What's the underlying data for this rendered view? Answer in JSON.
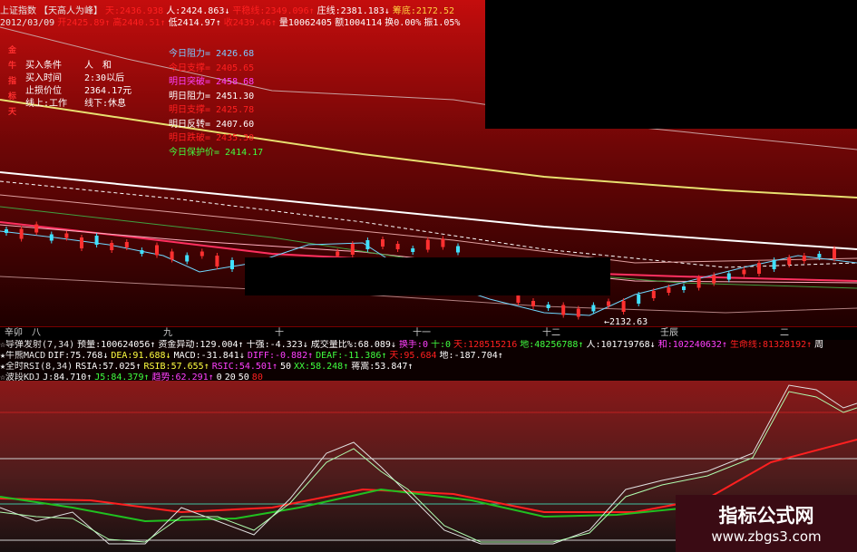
{
  "header": {
    "row1": [
      {
        "text": "上证指数",
        "color": "#e8e8e8"
      },
      {
        "text": "【天高人为峰】",
        "color": "#e8e8e8"
      },
      {
        "text": "天:2436.938",
        "color": "#ff2020"
      },
      {
        "text": "人:2424.863↓",
        "color": "#ffffff"
      },
      {
        "text": "平稳线:2349.096↑",
        "color": "#ff2020"
      },
      {
        "text": "庄线:2381.183↓",
        "color": "#ffffff"
      },
      {
        "text": "筹底:2172.52",
        "color": "#ffd040"
      }
    ],
    "row2": [
      {
        "text": "2012/03/09",
        "color": "#e8e8e8"
      },
      {
        "text": "开2425.89↑",
        "color": "#ff2020"
      },
      {
        "text": "高2440.51↑",
        "color": "#ff2020"
      },
      {
        "text": "低2414.97↑",
        "color": "#ffffff"
      },
      {
        "text": "收2439.46↑",
        "color": "#ff2020"
      },
      {
        "text": "量10062405",
        "color": "#ffffff"
      },
      {
        "text": "额1004114",
        "color": "#ffffff"
      },
      {
        "text": "换0.00%",
        "color": "#ffffff"
      },
      {
        "text": "振1.05%",
        "color": "#ffffff"
      }
    ]
  },
  "plan": {
    "side_chars": [
      "金",
      "牛",
      "指",
      "标",
      "天"
    ],
    "rows": [
      {
        "label": "买入条件",
        "value": "人　和"
      },
      {
        "label": "买入时间",
        "value": "2:30以后"
      },
      {
        "label": "止损价位",
        "value": "2364.17元"
      },
      {
        "label": "线上:工作",
        "value": "线下:休息"
      }
    ]
  },
  "levels": [
    {
      "text": "今日阻力= 2426.68",
      "color": "#7cc8ff"
    },
    {
      "text": "今日支撑= 2405.65",
      "color": "#ff2020"
    },
    {
      "text": "明日突破= 2458.68",
      "color": "#ff40ff"
    },
    {
      "text": "明日阻力= 2451.30",
      "color": "#ffffff"
    },
    {
      "text": "明日支撑= 2425.78",
      "color": "#ff2020"
    },
    {
      "text": "明日反转= 2407.60",
      "color": "#ffffff"
    },
    {
      "text": "明日跌破= 2435.30",
      "color": "#ff2020"
    },
    {
      "text": "今日保护价= 2414.17",
      "color": "#40ff40"
    }
  ],
  "low_label": "←2132.63",
  "dates": [
    "辛卯",
    "八",
    "九",
    "十",
    "十一",
    "十二",
    "壬辰",
    "二"
  ],
  "indicators": [
    [
      {
        "text": "☆导弹发射(7,34)",
        "color": "#e8e8e8"
      },
      {
        "text": "预量:100624056↑",
        "color": "#ffffff"
      },
      {
        "text": "资金异动:129.004↑",
        "color": "#ffffff"
      },
      {
        "text": "十强:-4.323↓",
        "color": "#ffffff"
      },
      {
        "text": "成交量比%:68.089↓",
        "color": "#ffffff"
      },
      {
        "text": "换手:0",
        "color": "#ff40ff"
      },
      {
        "text": "十:0",
        "color": "#40ff40"
      },
      {
        "text": "天:128515216",
        "color": "#ff2020"
      },
      {
        "text": "地:48256788↑",
        "color": "#40ff40"
      },
      {
        "text": "人:101719768↓",
        "color": "#ffffff"
      },
      {
        "text": "和:102240632↑",
        "color": "#ff40ff"
      },
      {
        "text": "生命线:81328192↑",
        "color": "#ff2020"
      },
      {
        "text": "周",
        "color": "#ffffff"
      }
    ],
    [
      {
        "text": "★牛熊MACD",
        "color": "#e8e8e8"
      },
      {
        "text": "DIF:75.768↓",
        "color": "#ffffff"
      },
      {
        "text": "DEA:91.688↓",
        "color": "#ffff40"
      },
      {
        "text": "MACD:-31.841↓",
        "color": "#ffffff"
      },
      {
        "text": "DIFF:-0.882↑",
        "color": "#ff40ff"
      },
      {
        "text": "DEAF:-11.386↑",
        "color": "#40ff40"
      },
      {
        "text": "天:95.684",
        "color": "#ff2020"
      },
      {
        "text": "地:-187.704↑",
        "color": "#ffffff"
      }
    ],
    [
      {
        "text": "★全时RSI(8,34)",
        "color": "#e8e8e8"
      },
      {
        "text": "RSIA:57.025↑",
        "color": "#ffffff"
      },
      {
        "text": "RSIB:57.655↑",
        "color": "#ffff40"
      },
      {
        "text": "RSIC:54.501↑",
        "color": "#ff40ff"
      },
      {
        "text": "50",
        "color": "#ffffff"
      },
      {
        "text": "XX:58.248↑",
        "color": "#40ff40"
      },
      {
        "text": "蒋嵩:53.847↑",
        "color": "#ffffff"
      }
    ],
    [
      {
        "text": "☆波段KDJ",
        "color": "#e8e8e8"
      },
      {
        "text": "J:84.710↑",
        "color": "#ffffff"
      },
      {
        "text": "J5:84.379↑",
        "color": "#40ff40"
      },
      {
        "text": "趋势:62.291↑",
        "color": "#ff40ff"
      },
      {
        "text": "0",
        "color": "#ffffff"
      },
      {
        "text": "20",
        "color": "#ffffff"
      },
      {
        "text": "50",
        "color": "#ffffff"
      },
      {
        "text": "80",
        "color": "#ff2020"
      }
    ]
  ],
  "watermark": {
    "title": "指标公式网",
    "url": "www.zbgs3.com"
  }
}
